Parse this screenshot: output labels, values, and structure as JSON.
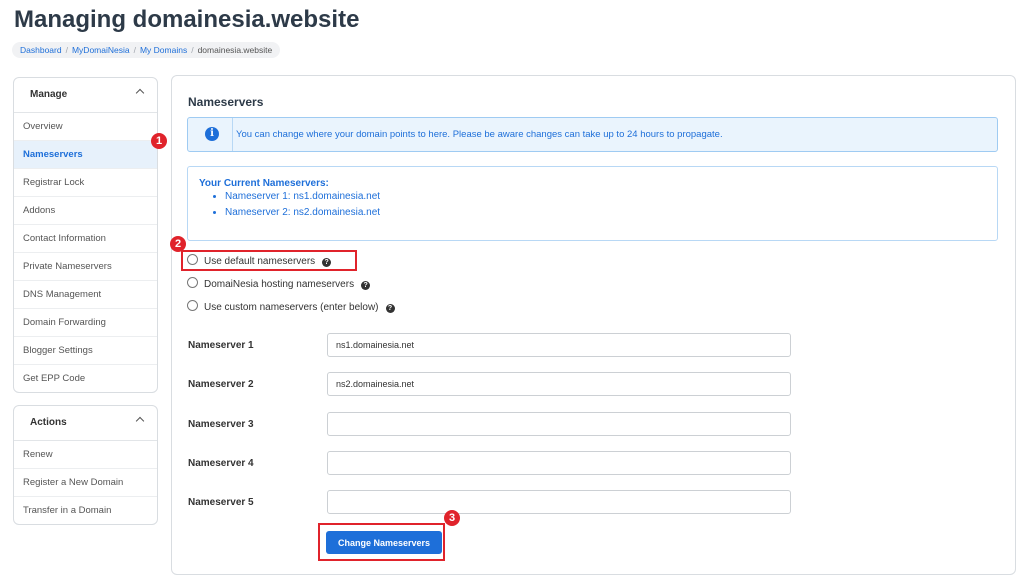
{
  "page": {
    "title": "Managing domainesia.website",
    "breadcrumb": [
      "Dashboard",
      "MyDomaiNesia",
      "My Domains",
      "domainesia.website"
    ],
    "breadcrumb_sep": "/"
  },
  "sidebar": {
    "manage": {
      "title": "Manage",
      "items": [
        "Overview",
        "Nameservers",
        "Registrar Lock",
        "Addons",
        "Contact Information",
        "Private Nameservers",
        "DNS Management",
        "Domain Forwarding",
        "Blogger Settings",
        "Get EPP Code"
      ],
      "active": "Nameservers"
    },
    "actions": {
      "title": "Actions",
      "items": [
        "Renew",
        "Register a New Domain",
        "Transfer in a Domain"
      ]
    }
  },
  "main": {
    "title": "Nameservers",
    "alert": {
      "icon": "info-icon",
      "icon_glyph": "i",
      "text": "You can change where your domain points to here. Please be aware changes can take up to 24 hours to propagate."
    },
    "current": {
      "title": "Your Current Nameservers:",
      "items": [
        "Nameserver 1: ns1.domainesia.net",
        "Nameserver 2: ns2.domainesia.net"
      ]
    },
    "options": [
      "Use default nameservers",
      "DomaiNesia hosting nameservers",
      "Use custom nameservers (enter below)"
    ],
    "help_glyph": "?",
    "fields": [
      {
        "label": "Nameserver 1",
        "value": "ns1.domainesia.net"
      },
      {
        "label": "Nameserver 2",
        "value": "ns2.domainesia.net"
      },
      {
        "label": "Nameserver 3",
        "value": ""
      },
      {
        "label": "Nameserver 4",
        "value": ""
      },
      {
        "label": "Nameserver 5",
        "value": ""
      }
    ],
    "submit_label": "Change Nameservers"
  },
  "annotations": {
    "badges": [
      "1",
      "2",
      "3"
    ],
    "color": "#e0232b"
  },
  "colors": {
    "primary": "#1e6fd9",
    "alert_bg": "#eaf4fd",
    "active_bg": "#e7f1fb",
    "title": "#2d3a48"
  }
}
